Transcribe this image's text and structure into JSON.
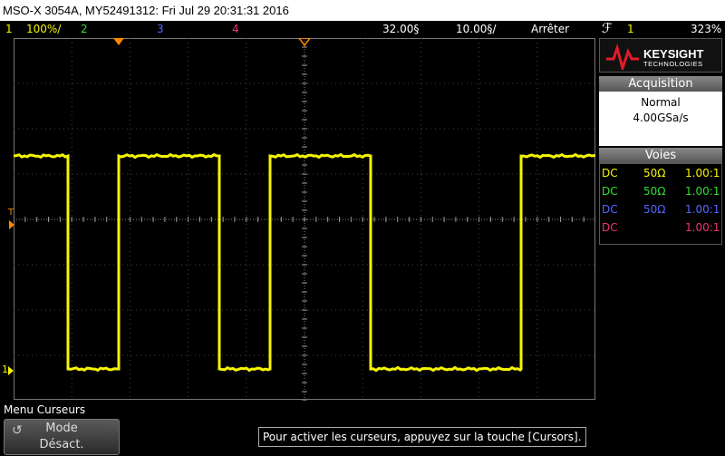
{
  "titlebar": {
    "text": "MSO-X 3054A, MY52491312: Fri Jul 29 20:31:31 2016"
  },
  "status": {
    "ch1_num": "1",
    "ch1_scale": "100%/",
    "ch2_num": "2",
    "ch3_num": "3",
    "ch4_num": "4",
    "timebase": "32.00§",
    "delay": "10.00§/",
    "run_state": "Arrêter",
    "trig_icon": "ℱ",
    "trig_source": "1",
    "trig_level": "323%"
  },
  "logo": {
    "brand": "KEYSIGHT",
    "sub": "TECHNOLOGIES"
  },
  "acquisition": {
    "title": "Acquisition",
    "mode": "Normal",
    "rate": "4.00GSa/s"
  },
  "voies": {
    "title": "Voies",
    "rows": [
      {
        "coupling": "DC",
        "imp": "50Ω",
        "ratio": "1.00:1",
        "color": "#f5f500"
      },
      {
        "coupling": "DC",
        "imp": "50Ω",
        "ratio": "1.00:1",
        "color": "#33dd33"
      },
      {
        "coupling": "DC",
        "imp": "50Ω",
        "ratio": "1.00:1",
        "color": "#5566ff"
      },
      {
        "coupling": "DC",
        "imp": "",
        "ratio": "1.00:1",
        "color": "#ee3377"
      }
    ]
  },
  "markers": {
    "trigger_T": "T",
    "ch1_ground": "1"
  },
  "menu": {
    "title": "Menu Curseurs",
    "mode_label": "Mode",
    "mode_value": "Désact."
  },
  "hint": "Pour activer les curseurs, appuyez sur la touche [Cursors].",
  "colors": {
    "ch1": "#f5f500",
    "ch2": "#33dd33",
    "ch3": "#5566ff",
    "ch4": "#ee3377",
    "trigger": "#ff8800",
    "grid": "#555555"
  }
}
